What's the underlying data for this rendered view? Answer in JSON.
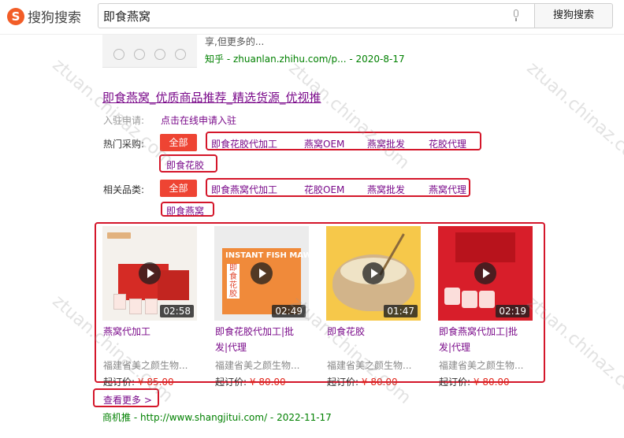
{
  "header": {
    "logo_text": "搜狗搜索",
    "search_value": "即食燕窝",
    "search_button": "搜狗搜索"
  },
  "previous_result": {
    "snippet": "享,但更多的...",
    "source": "知乎 - zhuanlan.zhihu.com/p... - 2020-8-17"
  },
  "result": {
    "title": "即食燕窝_优质商品推荐_精选货源_优视推",
    "entry_label": "入驻申请:",
    "entry_link": "点击在线申请入驻",
    "hot_label": "热门采购:",
    "hot_all": "全部",
    "hot_tags": [
      "即食花胶代加工",
      "燕窝OEM",
      "燕窝批发",
      "花胶代理",
      "即食花胶"
    ],
    "cat_label": "相关品类:",
    "cat_all": "全部",
    "cat_tags": [
      "即食燕窝代加工",
      "花胶OEM",
      "燕窝批发",
      "燕窝代理",
      "即食燕窝"
    ],
    "cards": [
      {
        "title_line1": "燕窝代加工",
        "title_line2": "",
        "duration": "02:58",
        "company": "福建省美之颜生物...",
        "price_label": "起订价:",
        "price": "¥ 85.00"
      },
      {
        "title_line1": "即食花胶代加工|批",
        "title_line2": "发|代理",
        "duration": "02:49",
        "company": "福建省美之颜生物...",
        "price_label": "起订价:",
        "price": "¥ 80.00",
        "image_text": "INSTANT FISH MAW",
        "image_box": "即食花胶"
      },
      {
        "title_line1": "即食花胶",
        "title_line2": "",
        "duration": "01:47",
        "company": "福建省美之颜生物...",
        "price_label": "起订价:",
        "price": "¥ 80.00"
      },
      {
        "title_line1": "即食燕窝代加工|批",
        "title_line2": "发|代理",
        "duration": "02:19",
        "company": "福建省美之颜生物...",
        "price_label": "起订价:",
        "price": "¥ 80.00"
      }
    ],
    "more": "查看更多 >",
    "source": "商机推 - http://www.shangjitui.com/ - 2022-11-17"
  },
  "watermark": "ztuan.chinaz.com",
  "colors": {
    "accent_red": "#ee4433",
    "highlight_box": "#d4162a",
    "visited_link": "#7a0a8a",
    "source_green": "#008000"
  }
}
